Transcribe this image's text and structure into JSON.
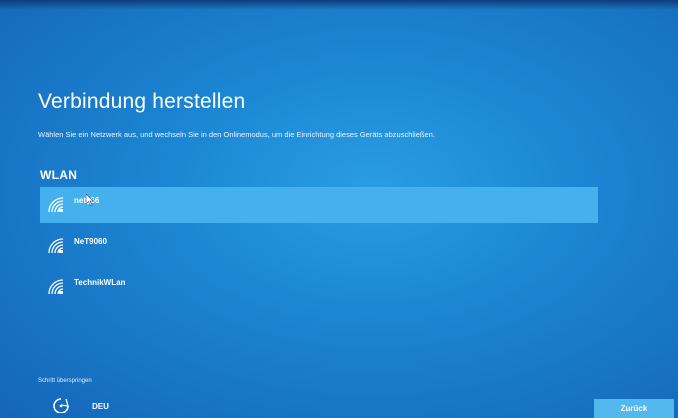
{
  "page": {
    "title": "Verbindung herstellen",
    "subtitle": "Wählen Sie ein Netzwerk aus, und wechseln Sie in den Onlinemodus, um die Einrichtung dieses Geräts abzuschließen."
  },
  "wlan": {
    "header": "WLAN",
    "networks": [
      {
        "name": "net▮66",
        "selected": true,
        "icon": "wifi-icon"
      },
      {
        "name": "NeT9060",
        "selected": false,
        "icon": "wifi-icon"
      },
      {
        "name": "TechnikWLan",
        "selected": false,
        "icon": "wifi-icon"
      }
    ]
  },
  "footer": {
    "skip_label": "Schritt überspringen",
    "accessibility_icon": "ease-of-access-icon",
    "language": "DEU",
    "back_label": "Zurück"
  },
  "colors": {
    "background": "#1b86d3",
    "selected_row": "#44b1ee",
    "back_button": "#53b8ee"
  }
}
